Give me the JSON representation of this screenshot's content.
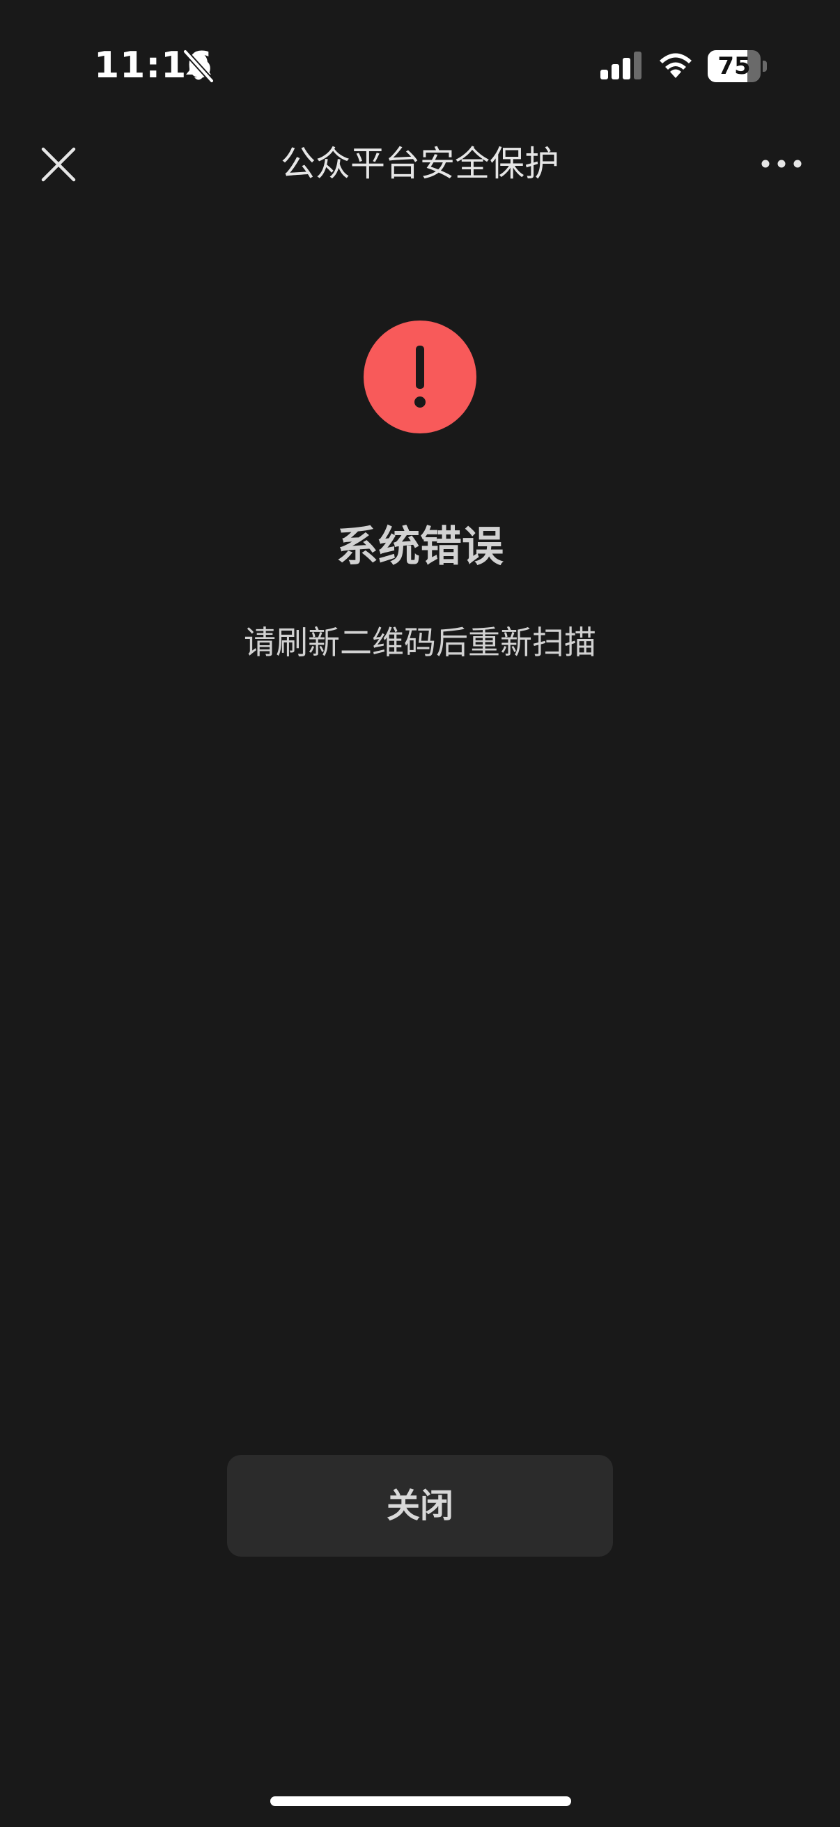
{
  "status_bar": {
    "time": "11:16",
    "battery_level": "75",
    "battery_fraction": 0.75,
    "silent_icon": "bell-slash-icon",
    "signal_icon": "cellular-signal-icon",
    "wifi_icon": "wifi-icon"
  },
  "nav": {
    "title": "公众平台安全保护",
    "close_icon": "close-icon",
    "more_icon": "more-dots-icon"
  },
  "error": {
    "icon": "exclamation-circle-icon",
    "icon_color": "#f85a5a",
    "title": "系统错误",
    "message": "请刷新二维码后重新扫描"
  },
  "actions": {
    "close_label": "关闭"
  },
  "colors": {
    "background": "#191919",
    "button_background": "#2b2b2b"
  }
}
